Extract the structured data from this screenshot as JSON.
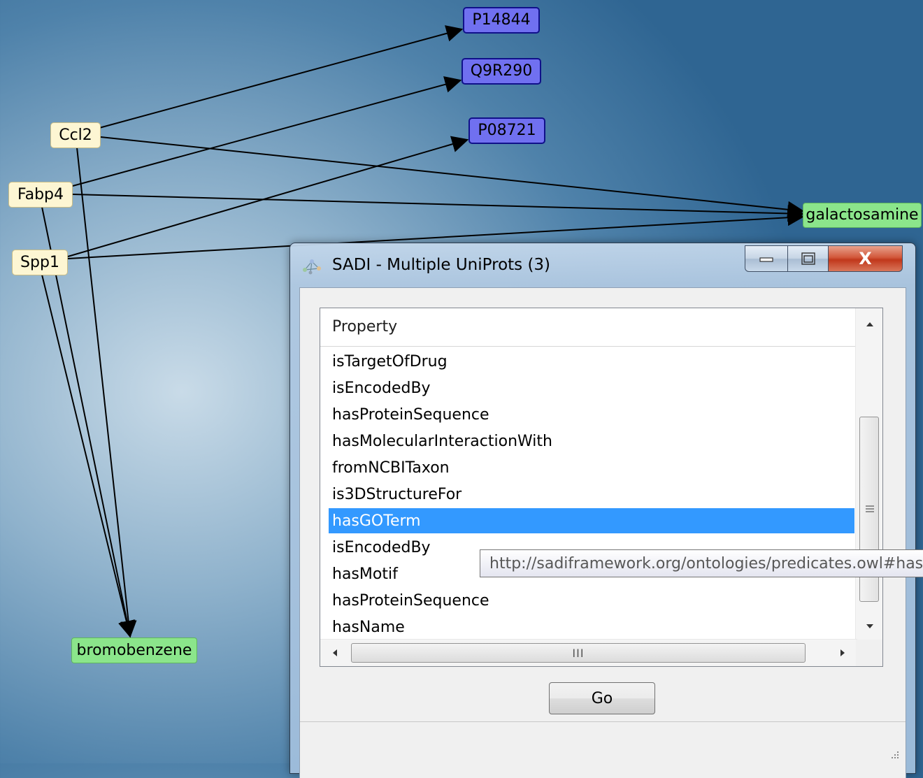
{
  "graph": {
    "genes": [
      "Ccl2",
      "Fabp4",
      "Spp1"
    ],
    "proteins": [
      "P14844",
      "Q9R290",
      "P08721"
    ],
    "chemicals": [
      "galactosamine",
      "bromobenzene"
    ]
  },
  "window": {
    "title": "SADI - Multiple UniProts (3)",
    "close_glyph": "X"
  },
  "list": {
    "header": "Property",
    "rows": [
      "isTargetOfDrug",
      "isEncodedBy",
      "hasProteinSequence",
      "hasMolecularInteractionWith",
      "fromNCBITaxon",
      "is3DStructureFor",
      "hasGOTerm",
      "isEncodedBy",
      "hasMotif",
      "hasProteinSequence",
      "hasName"
    ],
    "selected": "hasGOTerm"
  },
  "go_button": "Go",
  "hscroll_grip": "III",
  "tooltip": "http://sadiframework.org/ontologies/predicates.owl#hasGOTerm",
  "colors": {
    "selection": "#3399ff",
    "gene_node": "#fdf6d3",
    "protein_node": "#7070f0",
    "chemical_node": "#8be58b"
  }
}
